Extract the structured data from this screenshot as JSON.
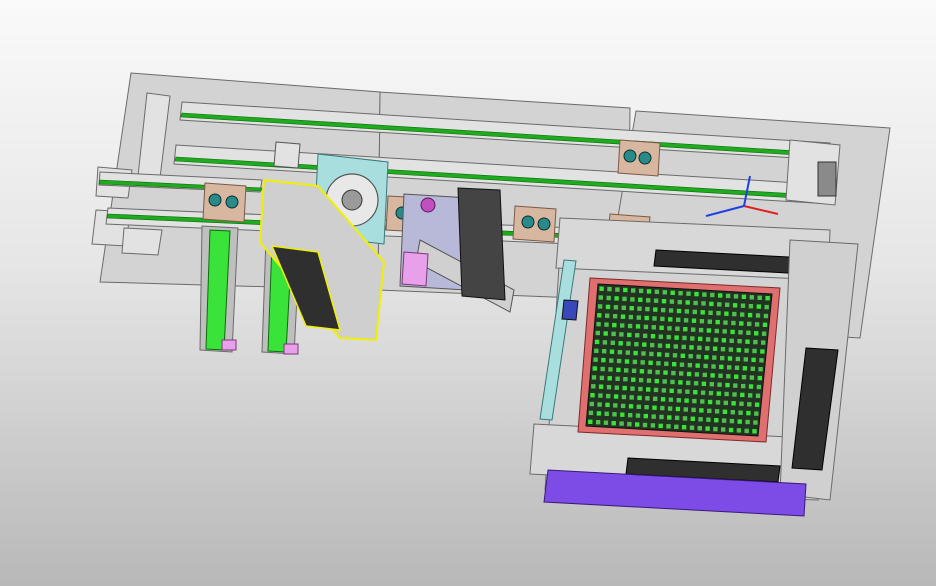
{
  "view": {
    "background_top": "#fafafa",
    "background_bottom": "#b8b8b8"
  },
  "colors": {
    "plate": "#d3d3d3",
    "plate_edge": "#6b6b6b",
    "rail": "#e2e2e2",
    "belt": "#1faa1f",
    "belt_light": "#39e339",
    "bracket": "#d8b7a0",
    "purple": "#7d4be6",
    "pink": "#e8a0ea",
    "selection": "#f0f000",
    "dark_panel": "#2f2f2f",
    "teal": "#a9dede",
    "grid_frame": "#e07070",
    "grid_field": "#223322",
    "blue_block": "#3848b8",
    "axis_x": "#e02020",
    "axis_y": "#2040e0"
  },
  "assembly": {
    "belt_conveyors": 4,
    "vertical_feeders": 2,
    "tray_rows": 16,
    "tray_columns": 22
  }
}
